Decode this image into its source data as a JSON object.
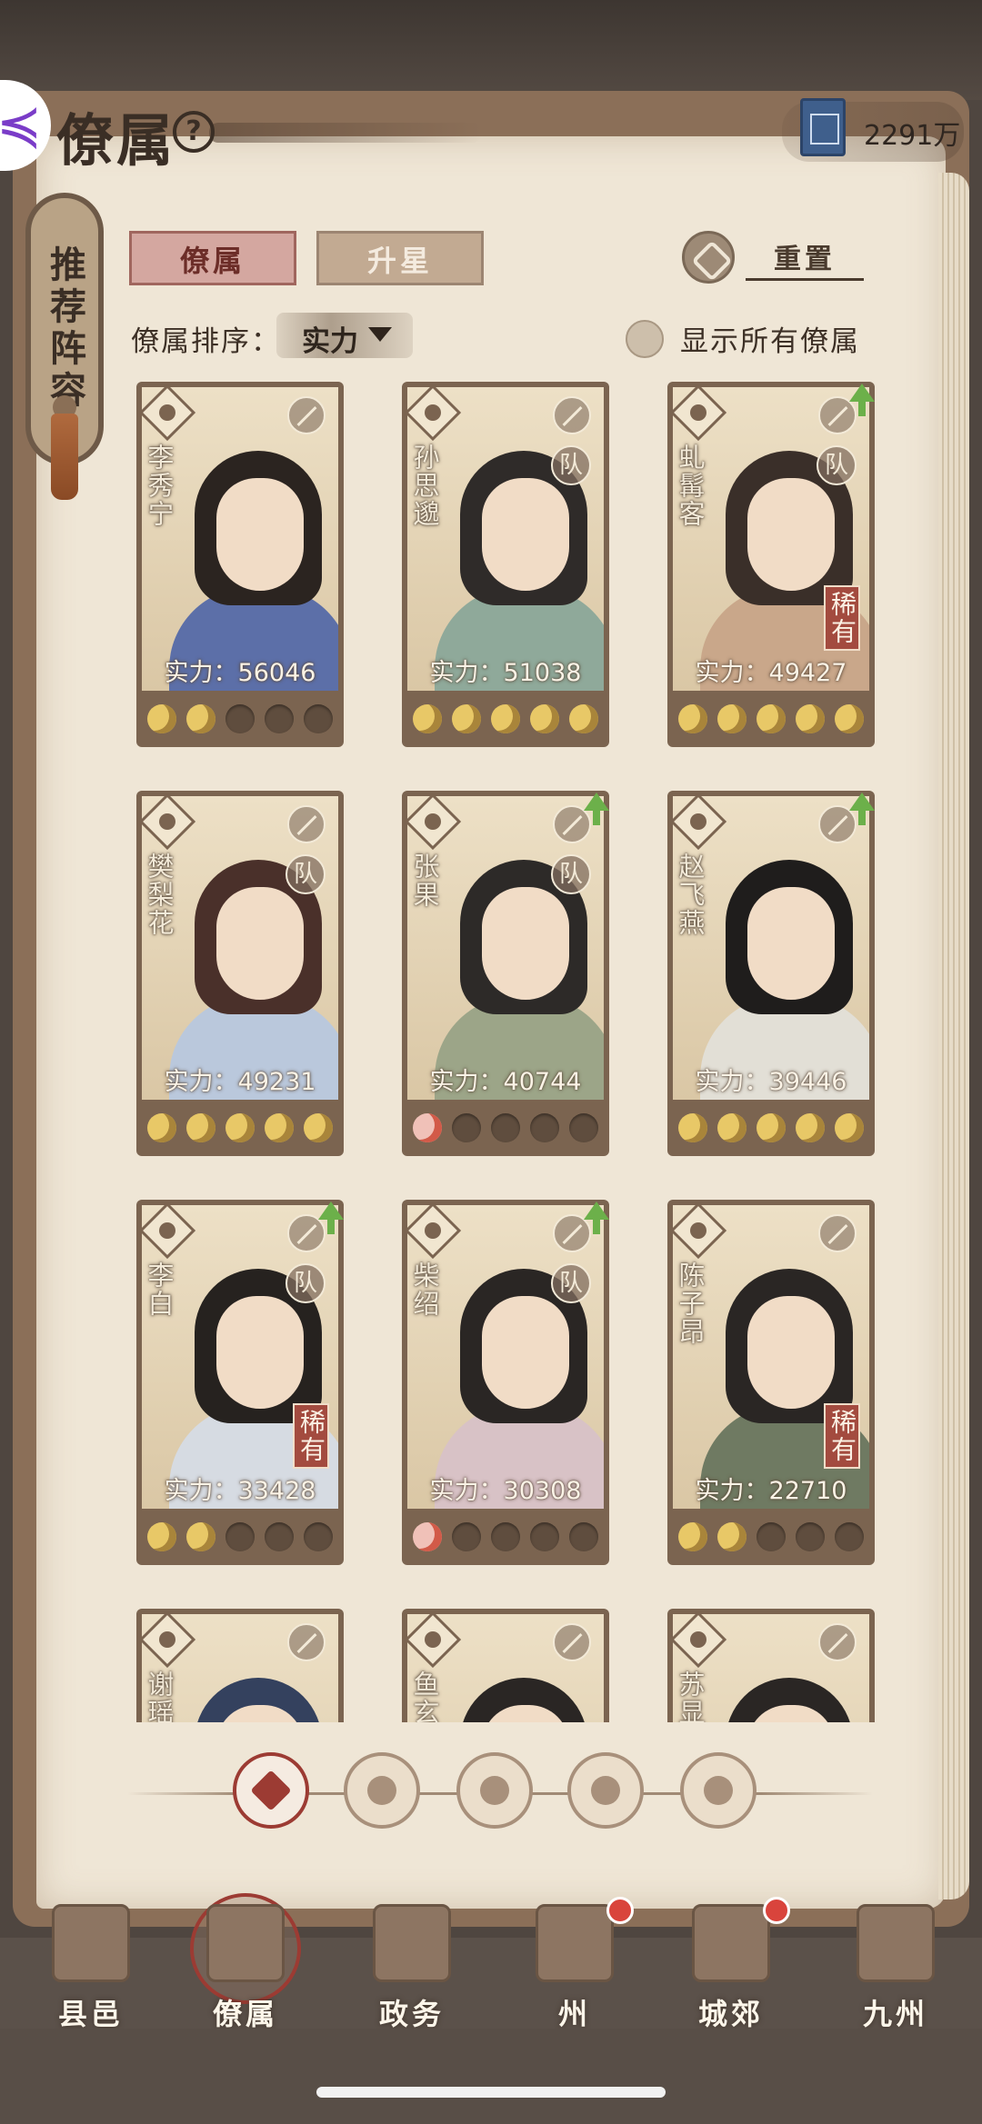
{
  "header": {
    "title": "僚属",
    "help": "?"
  },
  "currency": {
    "value": "2291万",
    "icon": "book-icon"
  },
  "recommend": {
    "label": "推荐阵容"
  },
  "tabs": [
    {
      "label": "僚属",
      "active": true
    },
    {
      "label": "升星",
      "active": false
    }
  ],
  "reset": {
    "label": "重置",
    "icon": "reset-icon"
  },
  "sort": {
    "label": "僚属排序：",
    "value": "实力"
  },
  "show_all": {
    "label": "显示所有僚属",
    "checked": false
  },
  "cards": [
    {
      "name": "李秀宁",
      "power": "实力：56046",
      "team": "",
      "rare": "",
      "upgrade": false,
      "stars": [
        1,
        1,
        0,
        0,
        0
      ],
      "star_color": "gold",
      "robe": "#5c6fa8",
      "hair": "#2b2420"
    },
    {
      "name": "孙思邈",
      "power": "实力：51038",
      "team": "队",
      "rare": "",
      "upgrade": false,
      "stars": [
        1,
        1,
        1,
        1,
        1
      ],
      "star_color": "gold",
      "robe": "#8fa99a",
      "hair": "#2f2b29"
    },
    {
      "name": "虬髯客",
      "power": "实力：49427",
      "team": "队",
      "rare": "稀有",
      "upgrade": true,
      "stars": [
        1,
        1,
        1,
        1,
        1
      ],
      "star_color": "gold",
      "robe": "#c9a78a",
      "hair": "#3a2f29"
    },
    {
      "name": "樊梨花",
      "power": "实力：49231",
      "team": "队",
      "rare": "",
      "upgrade": false,
      "stars": [
        1,
        1,
        1,
        1,
        1
      ],
      "star_color": "gold",
      "robe": "#bac8dc",
      "hair": "#4a302a"
    },
    {
      "name": "张果",
      "power": "实力：40744",
      "team": "队",
      "rare": "",
      "upgrade": true,
      "stars": [
        1,
        0,
        0,
        0,
        0
      ],
      "star_color": "red",
      "robe": "#9ca588",
      "hair": "#2d2a28"
    },
    {
      "name": "赵飞燕",
      "power": "实力：39446",
      "team": "",
      "rare": "",
      "upgrade": true,
      "stars": [
        1,
        1,
        1,
        1,
        1
      ],
      "star_color": "gold",
      "robe": "#e2dfd6",
      "hair": "#1f1d1c"
    },
    {
      "name": "李白",
      "power": "实力：33428",
      "team": "队",
      "rare": "稀有",
      "upgrade": true,
      "stars": [
        1,
        1,
        0,
        0,
        0
      ],
      "star_color": "gold",
      "robe": "#d6dbe2",
      "hair": "#26221f"
    },
    {
      "name": "柴绍",
      "power": "实力：30308",
      "team": "队",
      "rare": "",
      "upgrade": true,
      "stars": [
        1,
        0,
        0,
        0,
        0
      ],
      "star_color": "red",
      "robe": "#d8c2c6",
      "hair": "#2a2624"
    },
    {
      "name": "陈子昂",
      "power": "实力：22710",
      "team": "",
      "rare": "稀有",
      "upgrade": false,
      "stars": [
        1,
        1,
        0,
        0,
        0
      ],
      "star_color": "gold",
      "robe": "#6f7a62",
      "hair": "#2a2624"
    },
    {
      "name": "谢瑶",
      "power": "",
      "team": "",
      "rare": "",
      "upgrade": false,
      "stars": [
        0,
        0,
        0,
        0,
        0
      ],
      "star_color": "gold",
      "robe": "#3f4f7a",
      "hair": "#34415e"
    },
    {
      "name": "鱼玄",
      "power": "",
      "team": "",
      "rare": "",
      "upgrade": false,
      "stars": [
        0,
        0,
        0,
        0,
        0
      ],
      "star_color": "gold",
      "robe": "#d8cbb6",
      "hair": "#2a2624"
    },
    {
      "name": "苏显",
      "power": "",
      "team": "",
      "rare": "",
      "upgrade": false,
      "stars": [
        0,
        0,
        0,
        0,
        0
      ],
      "star_color": "gold",
      "robe": "#d8cbb6",
      "hair": "#2a2624"
    }
  ],
  "filters": [
    {
      "name": "all-filter",
      "active": true
    },
    {
      "name": "filter-class-1",
      "active": false
    },
    {
      "name": "filter-class-2",
      "active": false
    },
    {
      "name": "filter-class-3",
      "active": false
    },
    {
      "name": "filter-class-4",
      "active": false
    }
  ],
  "nav": [
    {
      "label": "县邑",
      "icon": "county-gate-icon",
      "active": false,
      "dot": false
    },
    {
      "label": "僚属",
      "icon": "scroll-portrait-icon",
      "active": true,
      "dot": false
    },
    {
      "label": "政务",
      "icon": "documents-icon",
      "active": false,
      "dot": false
    },
    {
      "label": "州",
      "icon": "prefecture-icon",
      "active": false,
      "dot": true
    },
    {
      "label": "城郊",
      "icon": "suburb-icon",
      "active": false,
      "dot": true
    },
    {
      "label": "九州",
      "icon": "map-scroll-icon",
      "active": false,
      "dot": false
    }
  ]
}
